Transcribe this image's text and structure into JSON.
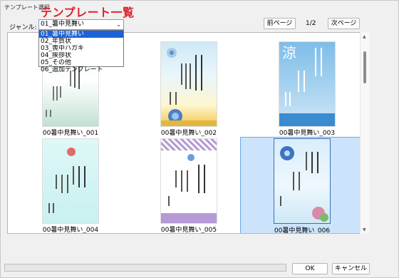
{
  "window": {
    "title": "テンプレート選択"
  },
  "header": {
    "title": "テンプレート一覧"
  },
  "genre": {
    "label": "ジャンル:",
    "selected": "01_暑中見舞い",
    "options": [
      "01_暑中見舞い",
      "02_年賀状",
      "03_喪中ハガキ",
      "04_挨拶状",
      "05_その他",
      "06_追加テンプレート"
    ]
  },
  "pager": {
    "prev_label": "前ページ",
    "page": "1/2",
    "next_label": "次ページ"
  },
  "templates": [
    {
      "name": "00暑中見舞い_001",
      "title_text": "暑中お見舞い申し上げます"
    },
    {
      "name": "00暑中見舞い_002",
      "title_text": "暑中お見舞い申し上げます"
    },
    {
      "name": "00暑中見舞い_003",
      "title_text": "暑中お見舞い申し上げます",
      "glyph": "涼"
    },
    {
      "name": "00暑中見舞い_004",
      "title_text": "暑中お見舞い申し上げます"
    },
    {
      "name": "00暑中見舞い_005",
      "title_text": "暑中お見舞い申し上げます"
    },
    {
      "name": "00暑中見舞い_006",
      "title_text": "暑中お見舞い申し上げます"
    }
  ],
  "footer": {
    "ok_label": "OK",
    "cancel_label": "キャンセル"
  },
  "colors": {
    "accent": "#e0202a",
    "selection": "#1c62d6",
    "selected_card": "#cce4fb"
  }
}
